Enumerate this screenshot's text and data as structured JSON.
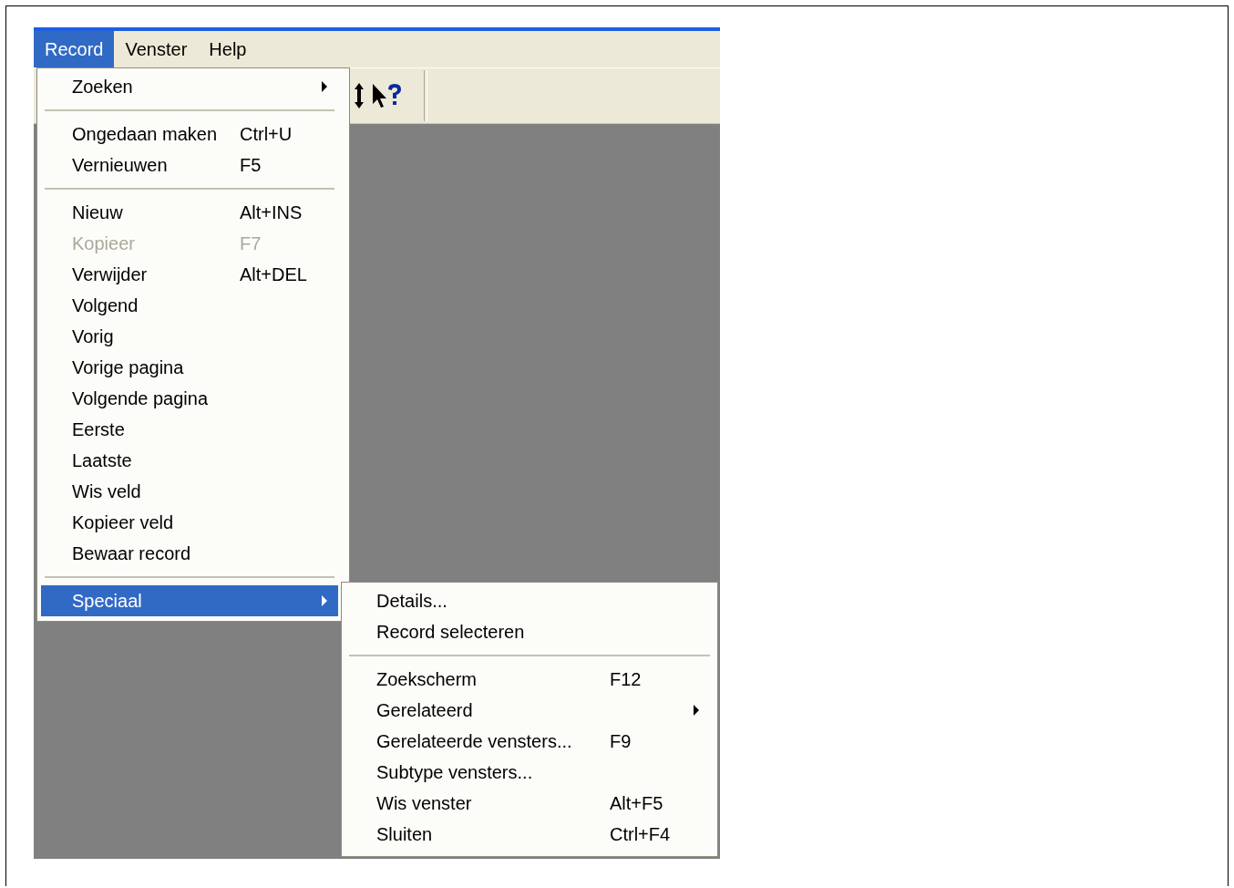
{
  "menubar": [
    {
      "label": "Record",
      "selected": true
    },
    {
      "label": "Venster",
      "selected": false
    },
    {
      "label": "Help",
      "selected": false
    }
  ],
  "record_menu": [
    {
      "kind": "item",
      "label": "Zoeken",
      "submenu": true,
      "disabled": false,
      "selected": false
    },
    {
      "kind": "separator"
    },
    {
      "kind": "item",
      "label": "Ongedaan maken",
      "shortcut": "Ctrl+U",
      "submenu": false,
      "disabled": false,
      "selected": false
    },
    {
      "kind": "item",
      "label": "Vernieuwen",
      "shortcut": "F5",
      "submenu": false,
      "disabled": false,
      "selected": false
    },
    {
      "kind": "separator"
    },
    {
      "kind": "item",
      "label": "Nieuw",
      "shortcut": "Alt+INS",
      "submenu": false,
      "disabled": false,
      "selected": false
    },
    {
      "kind": "item",
      "label": "Kopieer",
      "shortcut": "F7",
      "submenu": false,
      "disabled": true,
      "selected": false
    },
    {
      "kind": "item",
      "label": "Verwijder",
      "shortcut": "Alt+DEL",
      "submenu": false,
      "disabled": false,
      "selected": false
    },
    {
      "kind": "item",
      "label": "Volgend",
      "submenu": false,
      "disabled": false,
      "selected": false
    },
    {
      "kind": "item",
      "label": "Vorig",
      "submenu": false,
      "disabled": false,
      "selected": false
    },
    {
      "kind": "item",
      "label": "Vorige pagina",
      "submenu": false,
      "disabled": false,
      "selected": false
    },
    {
      "kind": "item",
      "label": "Volgende pagina",
      "submenu": false,
      "disabled": false,
      "selected": false
    },
    {
      "kind": "item",
      "label": "Eerste",
      "submenu": false,
      "disabled": false,
      "selected": false
    },
    {
      "kind": "item",
      "label": "Laatste",
      "submenu": false,
      "disabled": false,
      "selected": false
    },
    {
      "kind": "item",
      "label": "Wis veld",
      "submenu": false,
      "disabled": false,
      "selected": false
    },
    {
      "kind": "item",
      "label": "Kopieer veld",
      "submenu": false,
      "disabled": false,
      "selected": false
    },
    {
      "kind": "item",
      "label": "Bewaar record",
      "submenu": false,
      "disabled": false,
      "selected": false
    },
    {
      "kind": "separator"
    },
    {
      "kind": "item",
      "label": "Speciaal",
      "submenu": true,
      "disabled": false,
      "selected": true
    }
  ],
  "speciaal_submenu": [
    {
      "kind": "item",
      "label": "Details...",
      "submenu": false,
      "disabled": false,
      "selected": false
    },
    {
      "kind": "item",
      "label": "Record selecteren",
      "submenu": false,
      "disabled": false,
      "selected": false
    },
    {
      "kind": "separator"
    },
    {
      "kind": "item",
      "label": "Zoekscherm",
      "shortcut": "F12",
      "submenu": false,
      "disabled": false,
      "selected": false
    },
    {
      "kind": "item",
      "label": "Gerelateerd",
      "submenu": true,
      "disabled": false,
      "selected": false
    },
    {
      "kind": "item",
      "label": "Gerelateerde vensters...",
      "shortcut": "F9",
      "submenu": false,
      "disabled": false,
      "selected": false
    },
    {
      "kind": "item",
      "label": "Subtype vensters...",
      "submenu": false,
      "disabled": false,
      "selected": false
    },
    {
      "kind": "item",
      "label": "Wis venster",
      "shortcut": "Alt+F5",
      "submenu": false,
      "disabled": false,
      "selected": false
    },
    {
      "kind": "item",
      "label": "Sluiten",
      "shortcut": "Ctrl+F4",
      "submenu": false,
      "disabled": false,
      "selected": false
    }
  ]
}
